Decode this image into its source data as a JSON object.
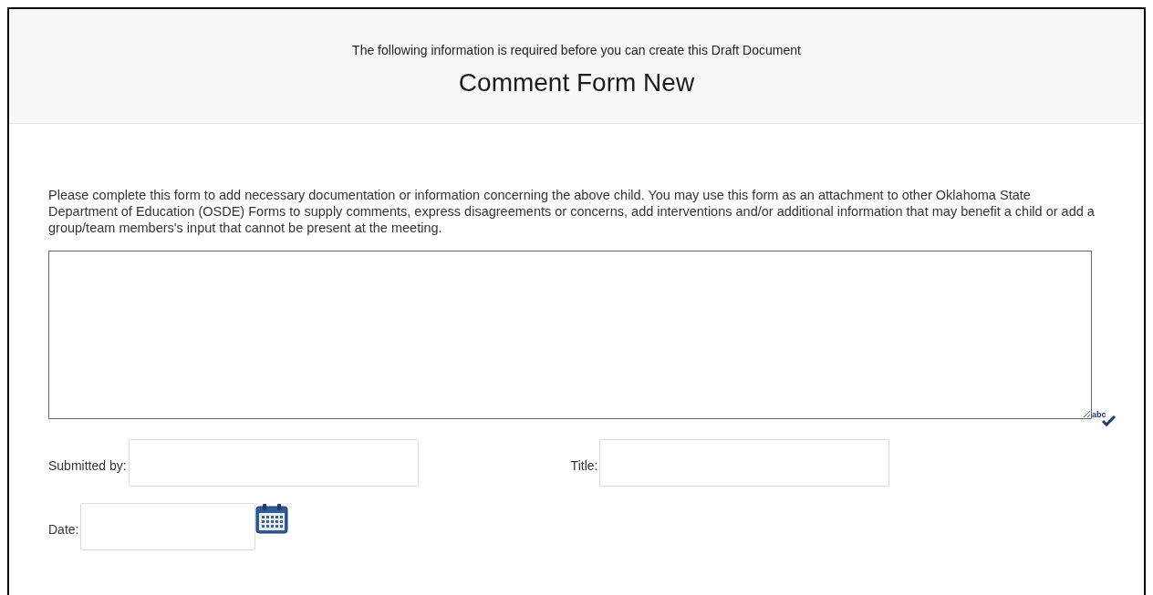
{
  "header": {
    "subtitle": "The following information is required before you can create this Draft Document",
    "title": "Comment Form New"
  },
  "instructions": "Please complete this form to add necessary documentation or information concerning the above child. You may use this form as an attachment to other Oklahoma State Department of Education (OSDE) Forms to supply comments, express disagreements or concerns, add interventions and/or additional information that may benefit a child or add a group/team members's input that cannot be present at the meeting.",
  "spellcheck": {
    "text": "abc"
  },
  "fields": [
    {
      "label": "Submitted by:",
      "kind": "text"
    },
    {
      "label": "Title:",
      "kind": "text"
    },
    {
      "label": "Date:",
      "kind": "date"
    }
  ]
}
